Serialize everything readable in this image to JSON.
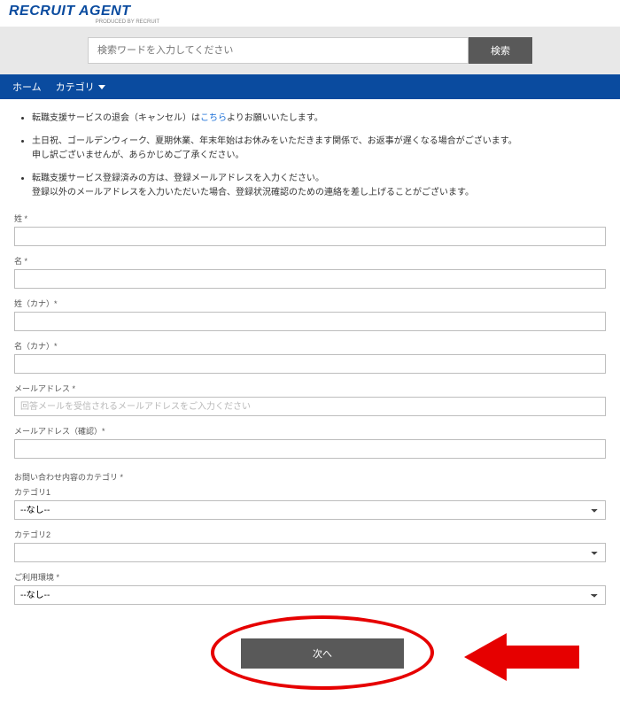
{
  "logo": {
    "text": "RECRUIT AGENT",
    "sub": "PRODUCED BY RECRUIT"
  },
  "search": {
    "placeholder": "検索ワードを入力してください",
    "button": "検索"
  },
  "nav": {
    "home": "ホーム",
    "category": "カテゴリ"
  },
  "notices": {
    "n1a": "転職支援サービスの退会（キャンセル）は",
    "n1link": "こちら",
    "n1b": "よりお願いいたします。",
    "n2a": "土日祝、ゴールデンウィーク、夏期休業、年末年始はお休みをいただきます関係で、お返事が遅くなる場合がございます。",
    "n2b": "申し訳ございませんが、あらかじめご了承ください。",
    "n3a": "転職支援サービス登録済みの方は、登録メールアドレスを入力ください。",
    "n3b": "登録以外のメールアドレスを入力いただいた場合、登録状況確認のための連絡を差し上げることがございます。"
  },
  "labels": {
    "sei": "姓 *",
    "mei": "名 *",
    "sei_kana": "姓（カナ）*",
    "mei_kana": "名（カナ）*",
    "email": "メールアドレス *",
    "email_placeholder": "回答メールを受信されるメールアドレスをご入力ください",
    "email_confirm": "メールアドレス（確認）*",
    "inquiry_cat": "お問い合わせ内容のカテゴリ *",
    "cat1": "カテゴリ1",
    "cat2": "カテゴリ2",
    "env": "ご利用環境 *",
    "select_none": "--なし--",
    "select_blank": ""
  },
  "submit": {
    "label": "次へ"
  }
}
